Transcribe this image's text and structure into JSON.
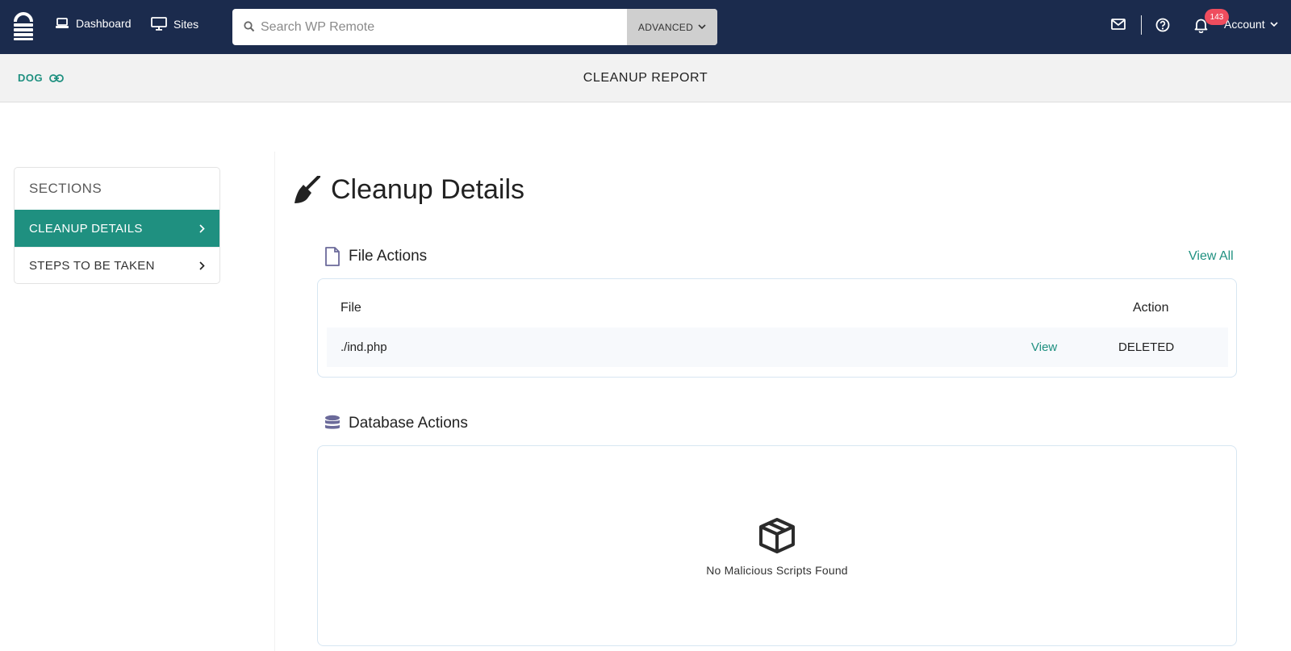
{
  "nav": {
    "dashboard_label": "Dashboard",
    "sites_label": "Sites",
    "search_placeholder": "Search WP Remote",
    "advanced_label": "ADVANCED",
    "notification_count": "143",
    "account_label": "Account"
  },
  "subheader": {
    "site_name": "DOG",
    "page_title": "CLEANUP REPORT"
  },
  "sidebar": {
    "heading": "SECTIONS",
    "items": [
      {
        "label": "CLEANUP DETAILS",
        "active": true
      },
      {
        "label": "STEPS TO BE TAKEN",
        "active": false
      }
    ]
  },
  "main": {
    "title": "Cleanup Details",
    "file_actions": {
      "heading": "File Actions",
      "view_all": "View All",
      "columns": [
        "File",
        "Action"
      ],
      "rows": [
        {
          "file": "./ind.php",
          "link": "View",
          "action": "DELETED"
        }
      ]
    },
    "database_actions": {
      "heading": "Database Actions",
      "empty_message": "No Malicious Scripts Found"
    }
  },
  "colors": {
    "navbar": "#1b2b4d",
    "accent": "#1f9080",
    "badge": "#ef4d5e"
  }
}
